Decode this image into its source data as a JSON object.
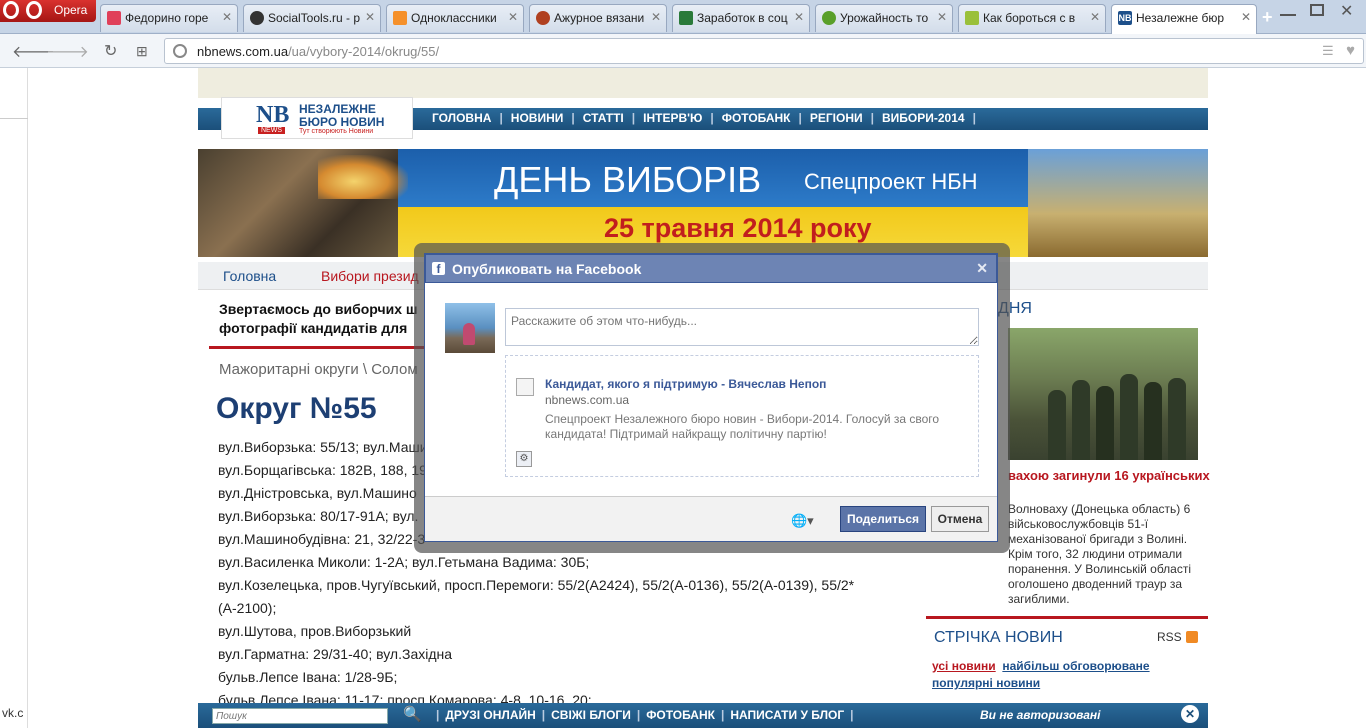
{
  "browser": {
    "opera_label": "Opera",
    "tabs": [
      {
        "title": "Федорино горе",
        "fav_color": "#e0405a"
      },
      {
        "title": "SocialTools.ru - р",
        "fav_color": "#333333"
      },
      {
        "title": "Одноклассники",
        "fav_color": "#f5902a"
      },
      {
        "title": "Ажурное вязани",
        "fav_color": "#b04020"
      },
      {
        "title": "Заработок в соц",
        "fav_color": "#2a7a3a"
      },
      {
        "title": "Урожайность то",
        "fav_color": "#5aa02a"
      },
      {
        "title": "Как бороться с в",
        "fav_color": "#9ac03a"
      },
      {
        "title": "Незалежне бюр",
        "fav_color": "#1d4f8a"
      }
    ],
    "url_domain": "nbnews.com.ua",
    "url_path": "/ua/vybory-2014/okrug/55/"
  },
  "site": {
    "logo_nb": "NB",
    "logo_news": "NEWS",
    "logo_line1": "НЕЗАЛЕЖНЕ",
    "logo_line2": "БЮРО НОВИН",
    "logo_tagline": "Тут створюють Новини",
    "menu": [
      "ГОЛОВНА",
      "НОВИНИ",
      "СТАТТІ",
      "ІНТЕРВ'Ю",
      "ФОТОБАНК",
      "РЕГІОНИ",
      "ВИБОРИ-2014"
    ],
    "banner_title": "ДЕНЬ ВИБОРІВ",
    "banner_sub": "Спецпроект НБН",
    "banner_date": "25 травня 2014 року",
    "subnav_home": "Головна",
    "subnav_elections": "Вибори презид"
  },
  "main": {
    "intro_line1": "Звертаємось до виборчих ш",
    "intro_line2": "фотографії кандидатів для",
    "breadcrumb": "Мажоритарні округи \\ Солом",
    "okrug_title": "Округ №55",
    "addresses": [
      "вул.Виборзька: 55/13; вул.Маши",
      "вул.Борщагівська: 182В, 188, 19",
      "вул.Дністровська, вул.Машино",
      "вул.Виборзька: 80/17-91А; вул.",
      "вул.Машинобудівна: 21, 32/22-3",
      "вул.Василенка Миколи: 1-2А; вул.Гетьмана Вадима: 30Б;",
      "вул.Козелецька, пров.Чугуївський, просп.Перемоги: 55/2(А2424), 55/2(А-0136), 55/2(А-0139), 55/2* (А-2100);",
      "вул.Шутова, пров.Виборзький",
      "вул.Гарматна: 29/31-40; вул.Західна",
      "бульв.Лепсе Івана: 1/28-9Б;",
      "бульв.Лепсе Івана: 11-17; просп.Комарова: 4-8, 10-16, 20;"
    ]
  },
  "right": {
    "head": "ДНЯ",
    "news_title": "вахою загинули 16 українських",
    "news_text": "Волноваху (Донецька область) 6 військовослужбовців 51-ї механізованої бригади з Волині. Крім того, 32 людини отримали поранення. У Волинській області оголошено дводенний траур за загиблими.",
    "feed_title": "СТРІЧКА НОВИН",
    "rss_label": "RSS",
    "tab_all": "усі новини",
    "tab_discussed": "найбільш обговорюване",
    "tab_popular": "популярні новини"
  },
  "fb": {
    "title": "Опубликовать на Facebook",
    "placeholder": "Расскажите об этом что-нибудь...",
    "link_title": "Кандидат, якого я підтримую - Вячеслав Непоп",
    "link_domain": "nbnews.com.ua",
    "link_desc": "Спецпроект Незалежного бюро новин - Вибори-2014. Голосуй за свого кандидата! Підтримай найкращу політичну партію!",
    "share_label": "Поделиться",
    "cancel_label": "Отмена"
  },
  "bottom": {
    "search_placeholder": "Пошук",
    "links": [
      "ДРУЗІ ОНЛАЙН",
      "СВІЖІ БЛОГИ",
      "ФОТОБАНК",
      "НАПИСАТИ У БЛОГ"
    ],
    "auth": "Ви не авторизовані",
    "vk_label": "vk.c"
  }
}
